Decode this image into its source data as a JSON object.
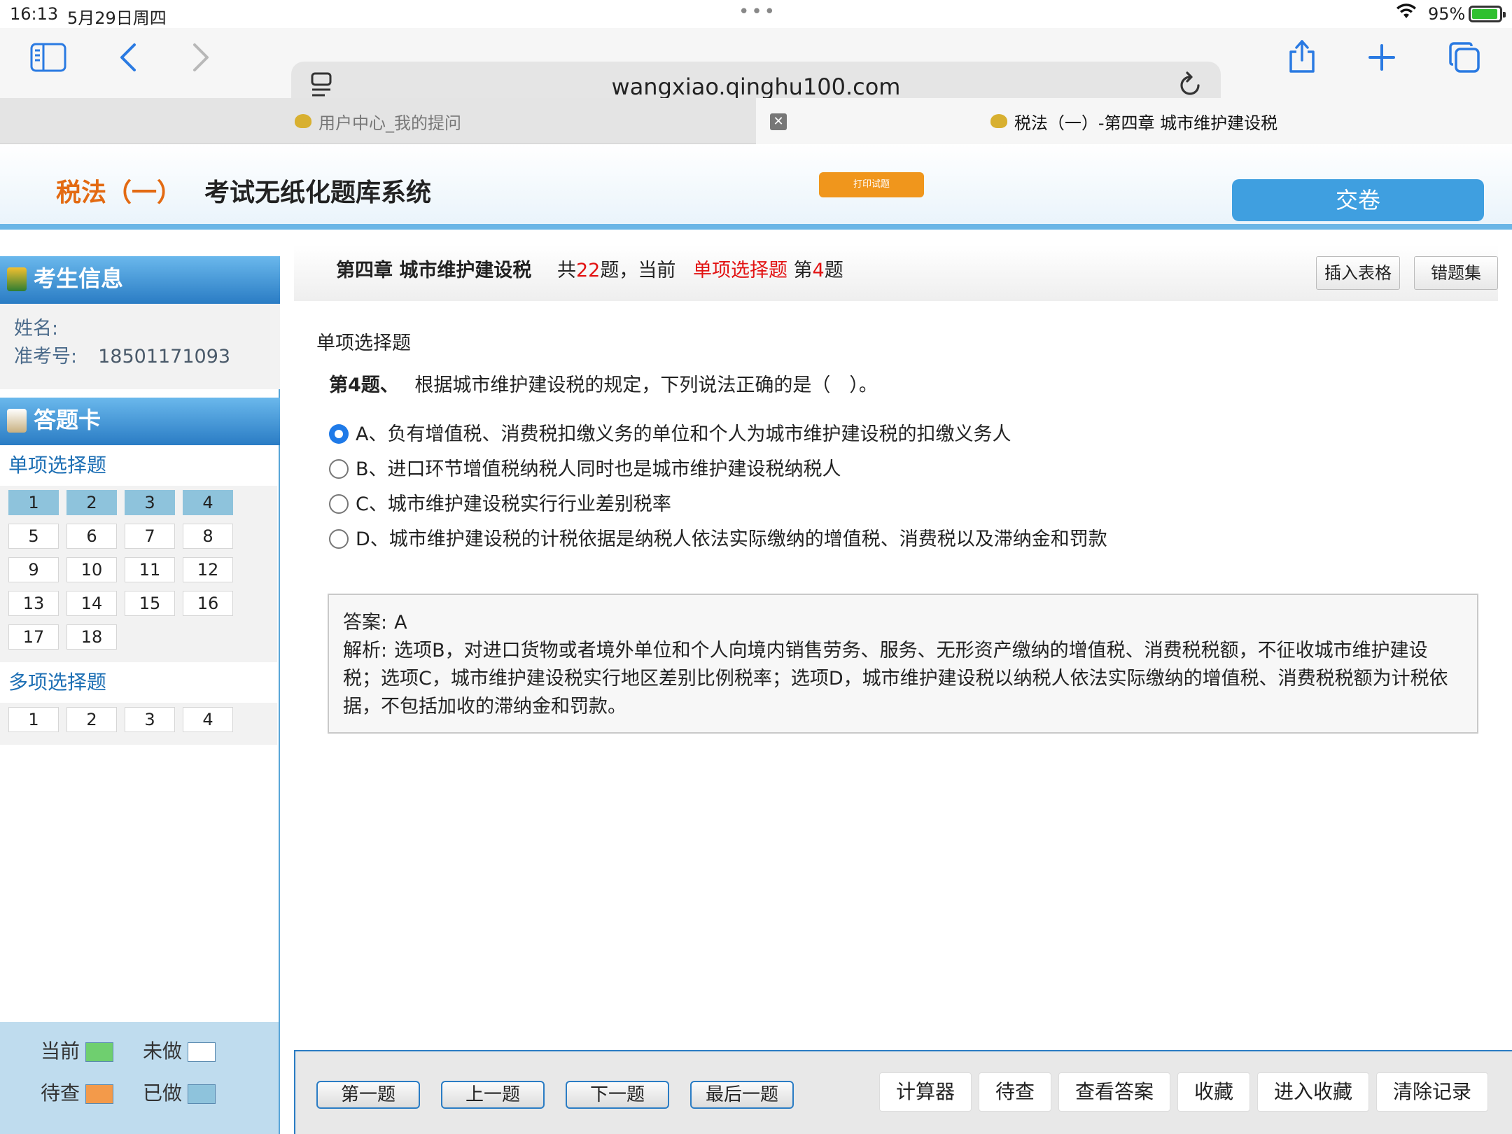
{
  "status": {
    "time": "16:13",
    "date": "5月29日周四",
    "battery": "95%"
  },
  "browser": {
    "url": "wangxiao.qinghu100.com"
  },
  "tabs": [
    {
      "title": "用户中心_我的提问"
    },
    {
      "title": "税法（一）-第四章 城市维护建设税"
    }
  ],
  "header": {
    "brand": "税法（一）",
    "system": "考试无纸化题库系统",
    "print_label": "打印试题",
    "submit_label": "交卷"
  },
  "sidebar": {
    "info_title": "考生信息",
    "name_label": "姓名:",
    "id_label": "准考号:",
    "id_value": "18501171093",
    "card_title": "答题卡",
    "single_title": "单项选择题",
    "single_items": [
      "1",
      "2",
      "3",
      "4",
      "5",
      "6",
      "7",
      "8",
      "9",
      "10",
      "11",
      "12",
      "13",
      "14",
      "15",
      "16",
      "17",
      "18"
    ],
    "multi_title": "多项选择题",
    "multi_items": [
      "1",
      "2",
      "3",
      "4"
    ],
    "legend": {
      "current": "当前",
      "undone": "未做",
      "pending": "待查",
      "done": "已做"
    },
    "legend_colors": {
      "current": "#6fcf6f",
      "undone": "#ffffff",
      "pending": "#f39a4a",
      "done": "#8ec3dc"
    }
  },
  "question_bar": {
    "chapter": "第四章 城市维护建设税",
    "total_prefix": "共",
    "total": "22",
    "total_suffix": "题，当前",
    "type": "单项选择题",
    "index_prefix": "第",
    "index": "4",
    "index_suffix": "题",
    "insert_table": "插入表格",
    "wrong_set": "错题集"
  },
  "question": {
    "type": "单项选择题",
    "number": "第4题、",
    "stem": "根据城市维护建设税的规定，下列说法正确的是（　）。",
    "options": [
      "A、负有增值税、消费税扣缴义务的单位和个人为城市维护建设税的扣缴义务人",
      "B、进口环节增值税纳税人同时也是城市维护建设税纳税人",
      "C、城市维护建设税实行行业差别税率",
      "D、城市维护建设税的计税依据是纳税人依法实际缴纳的增值税、消费税以及滞纳金和罚款"
    ],
    "selected": 0
  },
  "answer": {
    "answer_label": "答案:",
    "answer_value": "A",
    "analysis_label": "解析:",
    "analysis": "选项B，对进口货物或者境外单位和个人向境内销售劳务、服务、无形资产缴纳的增值税、消费税税额，不征收城市维护建设税；选项C，城市维护建设税实行地区差别比例税率；选项D，城市维护建设税以纳税人依法实际缴纳的增值税、消费税税额为计税依据，不包括加收的滞纳金和罚款。"
  },
  "nav": {
    "first": "第一题",
    "prev": "上一题",
    "next": "下一题",
    "last": "最后一题"
  },
  "tools": {
    "calculator": "计算器",
    "pending": "待查",
    "view_answer": "查看答案",
    "favorite": "收藏",
    "enter_favorite": "进入收藏",
    "clear": "清除记录"
  }
}
